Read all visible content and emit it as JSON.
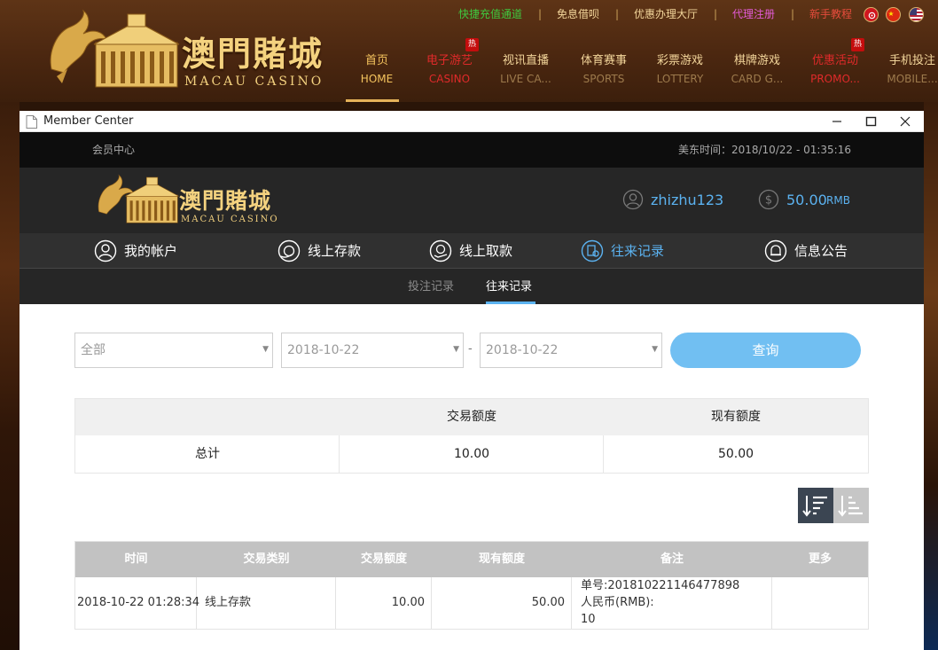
{
  "site": {
    "top_links": [
      {
        "label": "快捷充值通道",
        "color": "#3fc93f"
      },
      {
        "label": "免息借呗",
        "color": "#f2d59a"
      },
      {
        "label": "优惠办理大厅",
        "color": "#f2d59a"
      },
      {
        "label": "代理注册",
        "color": "#e35bd6"
      },
      {
        "label": "新手教程",
        "color": "#e74c3c"
      }
    ],
    "flags": [
      "hong-kong-flag-icon",
      "china-flag-icon",
      "usa-flag-icon"
    ],
    "logo_cn": "澳門賭城",
    "logo_en": "MACAU CASINO",
    "nav": [
      {
        "cn": "首页",
        "en": "HOME",
        "active": true,
        "hot": false
      },
      {
        "cn": "电子游艺",
        "en": "CASINO",
        "active": false,
        "hot": true,
        "red": true
      },
      {
        "cn": "视讯直播",
        "en": "LIVE CA...",
        "active": false,
        "hot": false
      },
      {
        "cn": "体育赛事",
        "en": "SPORTS",
        "active": false,
        "hot": false
      },
      {
        "cn": "彩票游戏",
        "en": "LOTTERY",
        "active": false,
        "hot": false
      },
      {
        "cn": "棋牌游戏",
        "en": "CARD G...",
        "active": false,
        "hot": false
      },
      {
        "cn": "优惠活动",
        "en": "PROMO...",
        "active": false,
        "hot": true,
        "red": true
      },
      {
        "cn": "手机投注",
        "en": "MOBILE...",
        "active": false,
        "hot": false
      }
    ],
    "hot_badge": "热"
  },
  "window": {
    "title": "Member Center",
    "controls": [
      "minimize-icon",
      "maximize-icon",
      "close-icon"
    ]
  },
  "member": {
    "breadcrumb": "会员中心",
    "server_time": "美东时间：2018/10/22 - 01:35:16",
    "logo_cn": "澳門賭城",
    "logo_en": "MACAU CASINO",
    "username": "zhizhu123",
    "balance": "50.00",
    "balance_unit": "RMB",
    "nav": [
      {
        "label": "我的帐户",
        "icon": "user-icon",
        "active": false
      },
      {
        "label": "线上存款",
        "icon": "deposit-icon",
        "active": false
      },
      {
        "label": "线上取款",
        "icon": "withdraw-icon",
        "active": false
      },
      {
        "label": "往来记录",
        "icon": "records-icon",
        "active": true
      },
      {
        "label": "信息公告",
        "icon": "bell-icon",
        "active": false
      }
    ],
    "sub_tabs": [
      {
        "label": "投注记录",
        "active": false
      },
      {
        "label": "往来记录",
        "active": true
      }
    ]
  },
  "filters": {
    "type": "全部",
    "date_from": "2018-10-22",
    "date_separator": "-",
    "date_to": "2018-10-22",
    "query_label": "查询"
  },
  "summary": {
    "headers": [
      "",
      "交易额度",
      "现有额度"
    ],
    "row": [
      "总计",
      "10.00",
      "50.00"
    ]
  },
  "records": {
    "headers": [
      "时间",
      "交易类别",
      "交易额度",
      "现有额度",
      "备注",
      "更多"
    ],
    "rows": [
      {
        "time": "2018-10-22 01:28:34",
        "type": "线上存款",
        "amount": "10.00",
        "balance": "50.00",
        "note_1": "单号:201810221146477898",
        "note_2": "人民币(RMB):",
        "note_3": "10",
        "more": ""
      }
    ]
  },
  "colors": {
    "accent": "#5bb2f0",
    "gold": "#f4d27f",
    "nav_active": "#f5c45e",
    "hot_red": "#e02a2a"
  }
}
